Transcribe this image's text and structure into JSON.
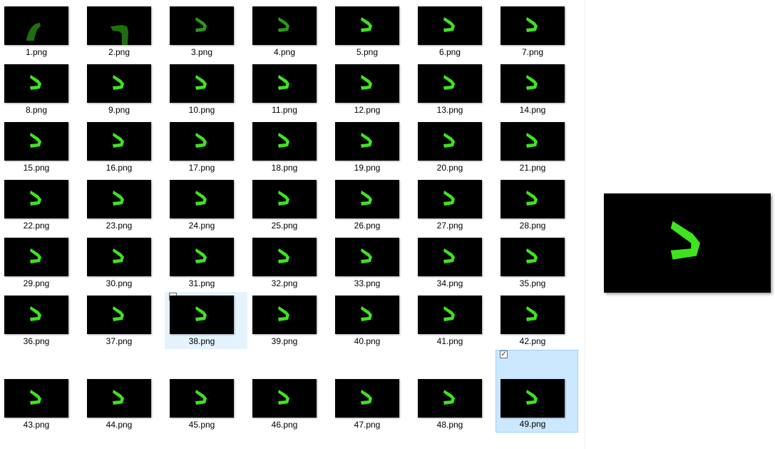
{
  "files": [
    {
      "name": "1.png",
      "frame": "early1"
    },
    {
      "name": "2.png",
      "frame": "early2"
    },
    {
      "name": "3.png",
      "frame": "dim"
    },
    {
      "name": "4.png",
      "frame": "dim"
    },
    {
      "name": "5.png",
      "frame": "normal"
    },
    {
      "name": "6.png",
      "frame": "normal"
    },
    {
      "name": "7.png",
      "frame": "normal"
    },
    {
      "name": "8.png",
      "frame": "normal"
    },
    {
      "name": "9.png",
      "frame": "normal"
    },
    {
      "name": "10.png",
      "frame": "normal"
    },
    {
      "name": "11.png",
      "frame": "normal"
    },
    {
      "name": "12.png",
      "frame": "normal"
    },
    {
      "name": "13.png",
      "frame": "normal"
    },
    {
      "name": "14.png",
      "frame": "normal"
    },
    {
      "name": "15.png",
      "frame": "normal"
    },
    {
      "name": "16.png",
      "frame": "normal"
    },
    {
      "name": "17.png",
      "frame": "normal"
    },
    {
      "name": "18.png",
      "frame": "normal"
    },
    {
      "name": "19.png",
      "frame": "normal"
    },
    {
      "name": "20.png",
      "frame": "normal"
    },
    {
      "name": "21.png",
      "frame": "normal"
    },
    {
      "name": "22.png",
      "frame": "normal"
    },
    {
      "name": "23.png",
      "frame": "normal"
    },
    {
      "name": "24.png",
      "frame": "normal"
    },
    {
      "name": "25.png",
      "frame": "normal"
    },
    {
      "name": "26.png",
      "frame": "normal"
    },
    {
      "name": "27.png",
      "frame": "normal"
    },
    {
      "name": "28.png",
      "frame": "normal"
    },
    {
      "name": "29.png",
      "frame": "normal"
    },
    {
      "name": "30.png",
      "frame": "normal"
    },
    {
      "name": "31.png",
      "frame": "normal"
    },
    {
      "name": "32.png",
      "frame": "normal"
    },
    {
      "name": "33.png",
      "frame": "normal"
    },
    {
      "name": "34.png",
      "frame": "normal"
    },
    {
      "name": "35.png",
      "frame": "normal"
    },
    {
      "name": "36.png",
      "frame": "normal"
    },
    {
      "name": "37.png",
      "frame": "normal"
    },
    {
      "name": "38.png",
      "frame": "normal",
      "state": "hover"
    },
    {
      "name": "39.png",
      "frame": "normal"
    },
    {
      "name": "40.png",
      "frame": "normal"
    },
    {
      "name": "41.png",
      "frame": "normal"
    },
    {
      "name": "42.png",
      "frame": "normal"
    },
    {
      "name": "43.png",
      "frame": "normal"
    },
    {
      "name": "44.png",
      "frame": "normal"
    },
    {
      "name": "45.png",
      "frame": "normal"
    },
    {
      "name": "46.png",
      "frame": "normal"
    },
    {
      "name": "47.png",
      "frame": "normal"
    },
    {
      "name": "48.png",
      "frame": "normal"
    },
    {
      "name": "49.png",
      "frame": "normal",
      "state": "selected"
    }
  ],
  "colors": {
    "shape_bright": "#3fe320",
    "shape_dim": "#2b9a17",
    "shape_early": "#1f6e10",
    "hover_bg": "#e5f3ff",
    "selected_bg": "#cce8ff",
    "selected_border": "#99d1ff"
  },
  "icons": {
    "shape": "green-v-shape-icon",
    "checkbox": "checkbox-icon"
  }
}
